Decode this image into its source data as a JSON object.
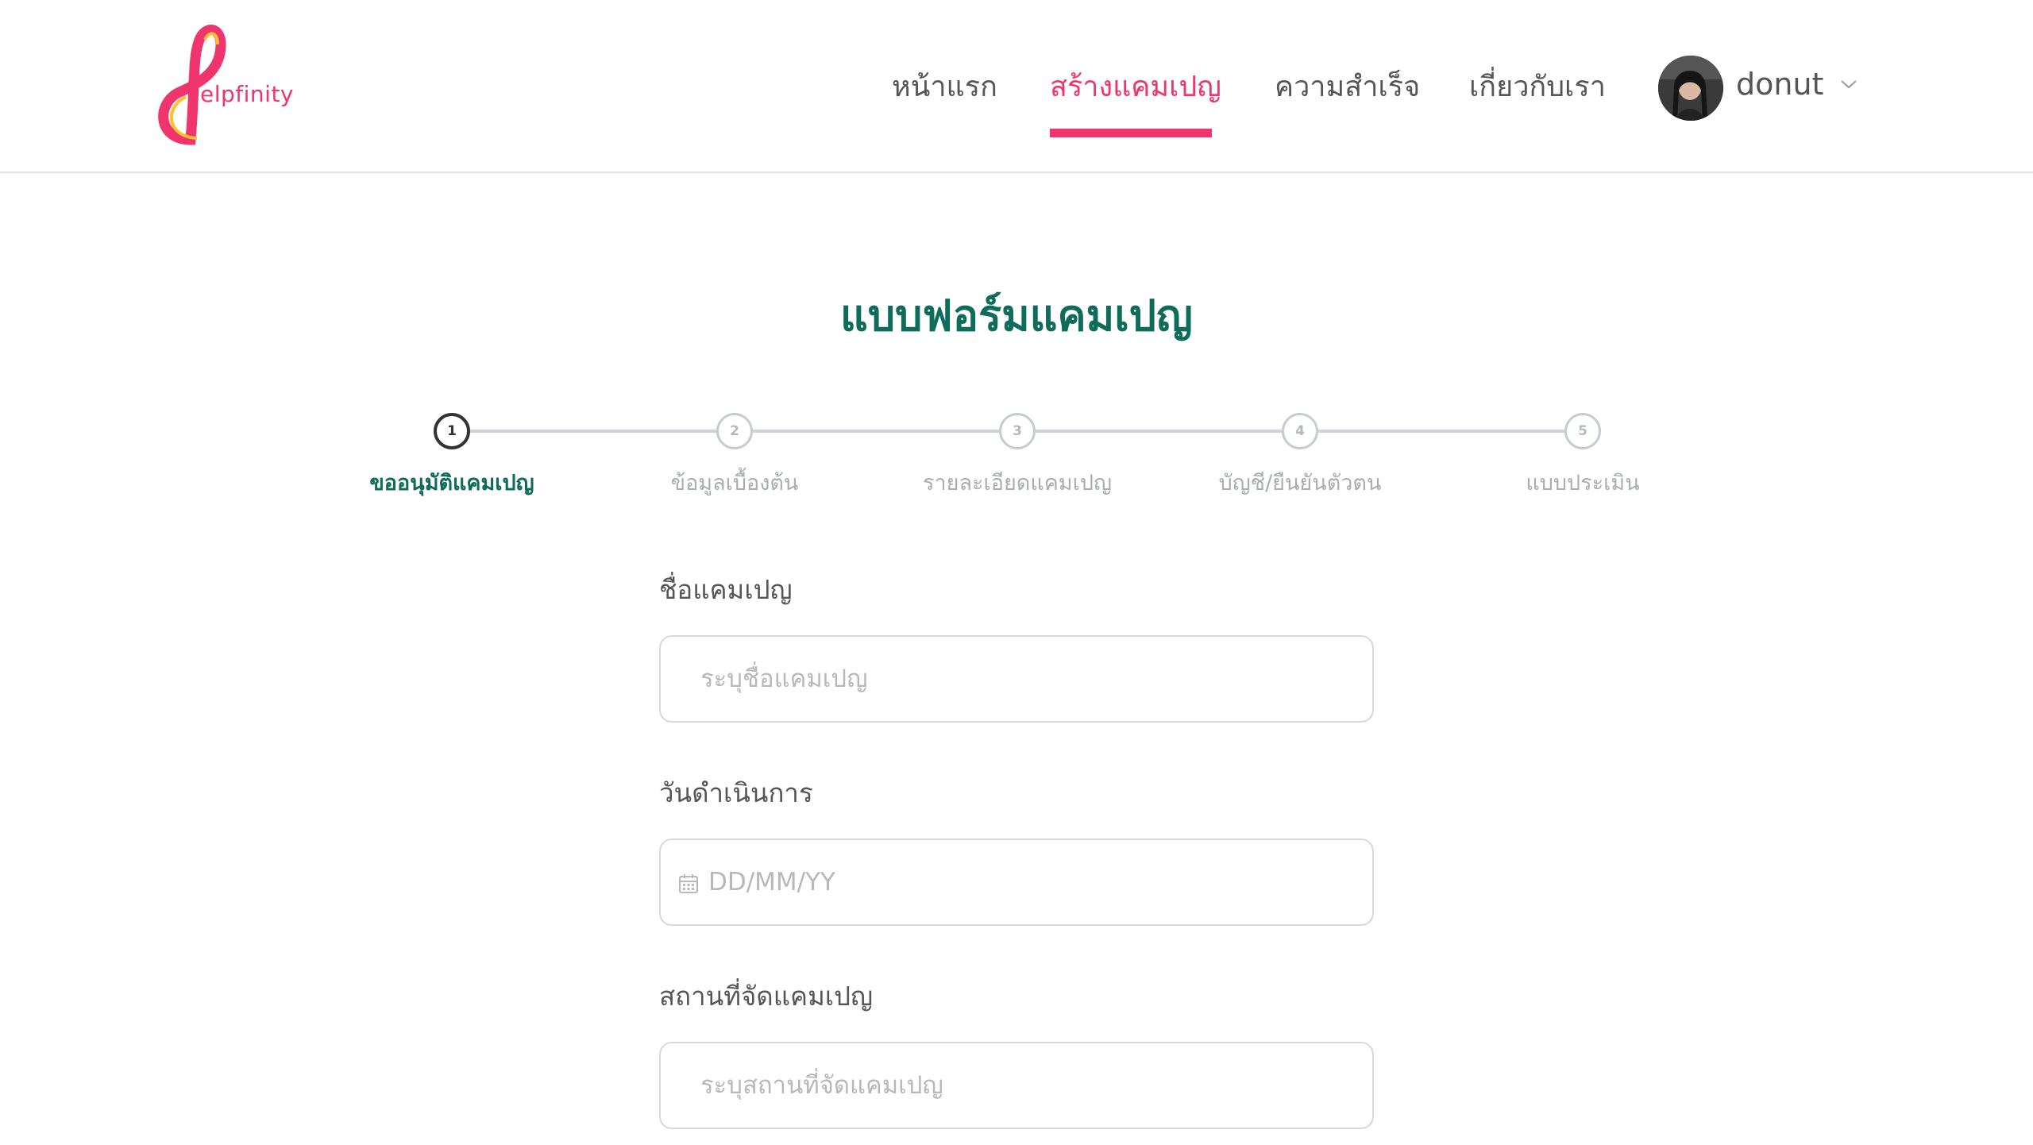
{
  "header": {
    "logo_text": "elpfinity",
    "nav": [
      {
        "label": "หน้าแรก",
        "active": false
      },
      {
        "label": "สร้างแคมเปญ",
        "active": true
      },
      {
        "label": "ความสำเร็จ",
        "active": false
      },
      {
        "label": "เกี่ยวกับเรา",
        "active": false
      }
    ],
    "user": {
      "name": "donut"
    },
    "brand_color": "#f0346e"
  },
  "main": {
    "title": "แบบฟอร์มแคมเปญ",
    "title_color": "#0f6b5a",
    "steps": [
      {
        "number": "1",
        "label": "ขออนุมัติแคมเปญ",
        "active": true
      },
      {
        "number": "2",
        "label": "ข้อมูลเบื้องต้น",
        "active": false
      },
      {
        "number": "3",
        "label": "รายละเอียดแคมเปญ",
        "active": false
      },
      {
        "number": "4",
        "label": "บัญชี/ยืนยันตัวตน",
        "active": false
      },
      {
        "number": "5",
        "label": "แบบประเมิน",
        "active": false
      }
    ],
    "form": {
      "campaign_name": {
        "label": "ชื่อแคมเปญ",
        "placeholder": "ระบุชื่อแคมเปญ",
        "value": ""
      },
      "operation_date": {
        "label": "วันดำเนินการ",
        "placeholder": "DD/MM/YY",
        "value": ""
      },
      "location": {
        "label": "สถานที่จัดแคมเปญ",
        "placeholder": "ระบุสถานที่จัดแคมเปญ",
        "value": ""
      }
    }
  }
}
